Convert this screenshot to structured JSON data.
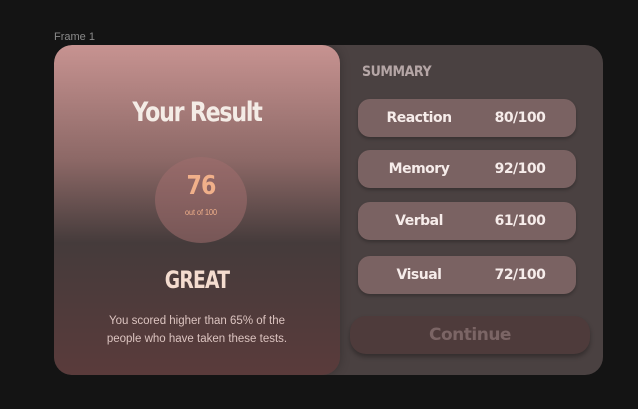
{
  "canvas": {
    "frame_label": "Frame 1"
  },
  "result": {
    "title": "Your Result",
    "score": "76",
    "score_subtext": "out of 100",
    "grade": "GREAT",
    "description": "You scored higher than 65% of the people who have taken these tests."
  },
  "summary": {
    "heading": "SUMMARY",
    "items": [
      {
        "label": "Reaction",
        "score": "80/100"
      },
      {
        "label": "Memory",
        "score": "92/100"
      },
      {
        "label": "Verbal",
        "score": "61/100"
      },
      {
        "label": "Visual",
        "score": "72/100"
      }
    ]
  },
  "actions": {
    "continue_label": "Continue"
  },
  "colors": {
    "background": "#141414",
    "card": "#4a4141",
    "accent": "#f1b08a",
    "summary_item": "#7a6262"
  }
}
